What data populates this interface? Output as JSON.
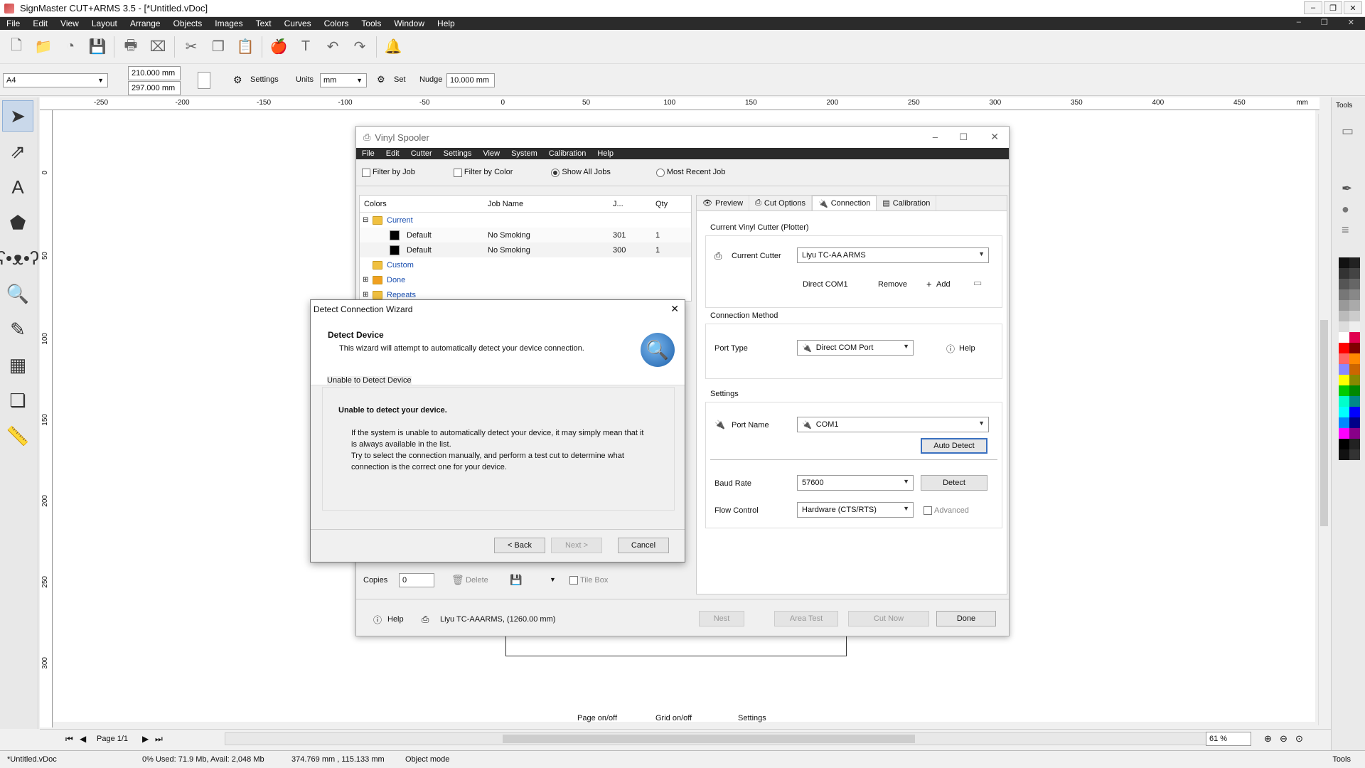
{
  "app": {
    "title": "SignMaster CUT+ARMS 3.5 - [*Untitled.vDoc]",
    "menu": [
      "File",
      "Edit",
      "View",
      "Layout",
      "Arrange",
      "Objects",
      "Images",
      "Text",
      "Curves",
      "Colors",
      "Tools",
      "Window",
      "Help"
    ]
  },
  "toolbar2": {
    "page_size": "A4",
    "width": "210.000 mm",
    "height": "297.000 mm",
    "settings": "Settings",
    "units_label": "Units",
    "units_value": "mm",
    "set": "Set",
    "nudge_label": "Nudge",
    "nudge_value": "10.000 mm"
  },
  "ruler": {
    "h_ticks": [
      "-250",
      "-200",
      "-150",
      "-100",
      "-50",
      "0",
      "50",
      "100",
      "150",
      "200",
      "250",
      "300",
      "350",
      "400",
      "450"
    ],
    "v_ticks": [
      "0",
      "50",
      "100",
      "150",
      "200",
      "250",
      "300"
    ],
    "h_unit": "mm"
  },
  "right_panel": {
    "label": "Tools",
    "colors": [
      "#111111",
      "#222222",
      "#333333",
      "#444444",
      "#555555",
      "#666666",
      "#777777",
      "#888888",
      "#999999",
      "#aaaaaa",
      "#bbbbbb",
      "#cccccc",
      "#dddddd",
      "#eeeeee",
      "#ffffff",
      "#e0004f",
      "#ff0000",
      "#800000",
      "#ff6666",
      "#ff8800",
      "#8888ff",
      "#cc6600",
      "#ffff00",
      "#888800",
      "#00cc00",
      "#008800",
      "#00ffcc",
      "#008888",
      "#00ffff",
      "#0000ff",
      "#0088ff",
      "#000088",
      "#ff00ff",
      "#880088",
      "#000000",
      "#222222",
      "#111111",
      "#333333"
    ]
  },
  "vinyl_spooler": {
    "title": "Vinyl Spooler",
    "menu": [
      "File",
      "Edit",
      "Cutter",
      "Settings",
      "View",
      "System",
      "Calibration",
      "Help"
    ],
    "filters": {
      "filter_job": "Filter by Job",
      "filter_color": "Filter by Color",
      "show_all": "Show All Jobs",
      "most_recent": "Most Recent Job"
    },
    "columns": {
      "colors": "Colors",
      "job_name": "Job Name",
      "j": "J...",
      "qty": "Qty"
    },
    "tree": {
      "current": "Current",
      "custom": "Custom",
      "done": "Done",
      "repeats": "Repeats"
    },
    "rows": [
      {
        "color": "Default",
        "job": "No Smoking",
        "j": "301",
        "qty": "1"
      },
      {
        "color": "Default",
        "job": "No Smoking",
        "j": "300",
        "qty": "1"
      }
    ],
    "tabs": [
      "Preview",
      "Cut Options",
      "Connection",
      "Calibration"
    ],
    "current_cutter_group": "Current Vinyl Cutter (Plotter)",
    "current_cutter_label": "Current Cutter",
    "current_cutter_value": "Liyu TC-AA ARMS",
    "direct_com": "Direct COM1",
    "remove": "Remove",
    "add": "Add",
    "connection_method": "Connection Method",
    "port_type_label": "Port Type",
    "port_type_value": "Direct COM Port",
    "help": "Help",
    "settings_group": "Settings",
    "port_name_label": "Port Name",
    "port_name_value": "COM1",
    "auto_detect": "Auto Detect",
    "baud_label": "Baud Rate",
    "baud_value": "57600",
    "detect": "Detect",
    "flow_label": "Flow Control",
    "flow_value": "Hardware (CTS/RTS)",
    "advanced": "Advanced",
    "copies_label": "Copies",
    "copies_value": "0",
    "delete": "Delete",
    "tile_box": "Tile Box",
    "help_bottom": "Help",
    "cutter_info": "Liyu TC-AAARMS,  (1260.00 mm)",
    "nest": "Nest",
    "area_test": "Area Test",
    "cut_now": "Cut Now",
    "done": "Done"
  },
  "wizard": {
    "title": "Detect Connection Wizard",
    "heading": "Detect Device",
    "subheading": "This wizard will attempt to automatically detect your device connection.",
    "group": "Unable to Detect Device",
    "msg_title": "Unable to detect your device.",
    "msg_l1": "If the system is unable to automatically detect your device, it may simply mean that it",
    "msg_l2": "is always available in the list.",
    "msg_l3": "Try to select the connection manually, and perform a test cut to determine what",
    "msg_l4": "connection is the correct one for your device.",
    "back": "< Back",
    "next": "Next >",
    "cancel": "Cancel"
  },
  "bottom": {
    "page": "Page 1/1",
    "page_onoff": "Page on/off",
    "grid_onoff": "Grid on/off",
    "settings": "Settings",
    "zoom": "61 %"
  },
  "status": {
    "doc": "*Untitled.vDoc",
    "mem": "0%  Used: 71.9 Mb, Avail: 2,048 Mb",
    "coords": "374.769 mm , 115.133 mm",
    "mode": "Object mode",
    "tools": "Tools"
  }
}
